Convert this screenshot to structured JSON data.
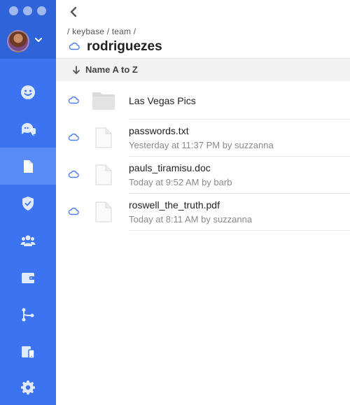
{
  "window": {
    "controls": [
      "close",
      "minimize",
      "maximize"
    ]
  },
  "sidebar": {
    "avatar": "user-avatar",
    "items": [
      {
        "id": "chat",
        "icon": "smiley-icon"
      },
      {
        "id": "teams-chat",
        "icon": "chat-bubbles-icon"
      },
      {
        "id": "files",
        "icon": "file-icon",
        "active": true
      },
      {
        "id": "crypto",
        "icon": "shield-check-icon"
      },
      {
        "id": "people",
        "icon": "people-icon"
      },
      {
        "id": "wallet",
        "icon": "wallet-icon"
      },
      {
        "id": "git",
        "icon": "git-branch-icon"
      },
      {
        "id": "devices",
        "icon": "devices-icon"
      },
      {
        "id": "settings",
        "icon": "gear-icon"
      }
    ]
  },
  "header": {
    "breadcrumb": "/ keybase / team /",
    "title": "rodriguezes"
  },
  "sort": {
    "label": "Name A to Z"
  },
  "files": [
    {
      "name": "Las Vegas Pics",
      "meta": "",
      "type": "folder"
    },
    {
      "name": "passwords.txt",
      "meta": "Yesterday at 11:37 PM by suzzanna",
      "type": "file"
    },
    {
      "name": "pauls_tiramisu.doc",
      "meta": "Today at 9:52 AM by barb",
      "type": "file"
    },
    {
      "name": "roswell_the_truth.pdf",
      "meta": "Today at 8:11 AM by suzzanna",
      "type": "file"
    }
  ],
  "colors": {
    "sidebar_top": "#2f63d9",
    "sidebar": "#3b73f0",
    "sidebar_active": "#5a8af5",
    "cloud": "#4a7ef0"
  }
}
